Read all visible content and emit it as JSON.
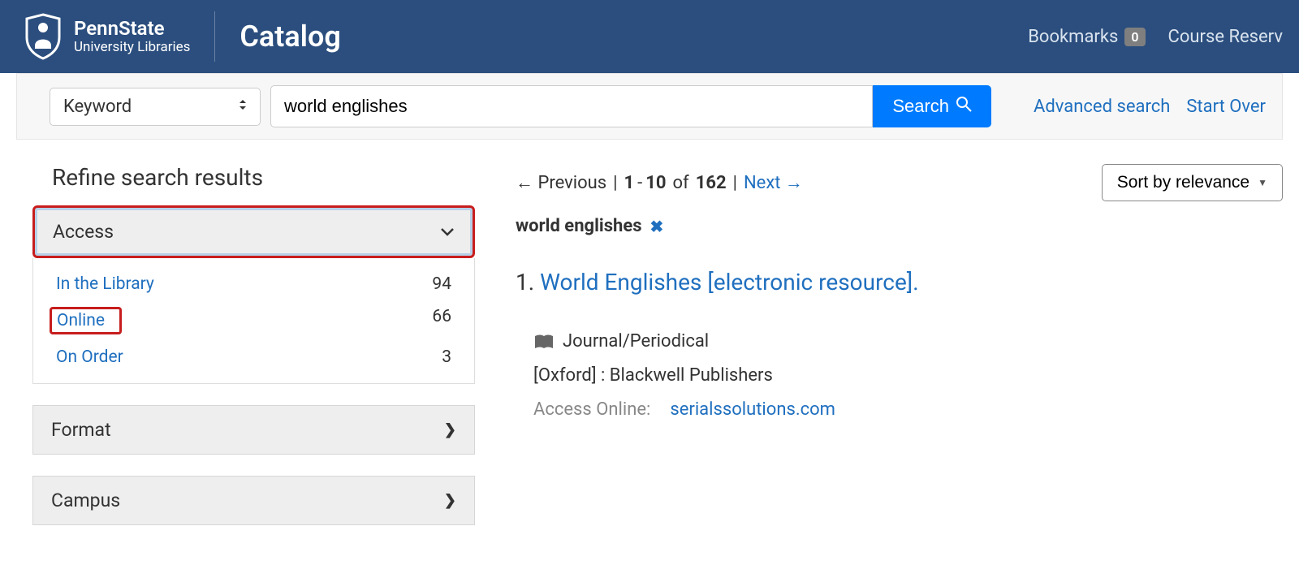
{
  "header": {
    "logo_title": "PennState",
    "logo_sub": "University Libraries",
    "app_title": "Catalog",
    "bookmarks_label": "Bookmarks",
    "bookmarks_count": "0",
    "reserves_label": "Course Reserv"
  },
  "search": {
    "type_label": "Keyword",
    "query": "world englishes",
    "button_label": "Search",
    "advanced_label": "Advanced search",
    "start_over_label": "Start Over"
  },
  "sidebar": {
    "heading": "Refine search results",
    "facets": [
      {
        "name": "Access",
        "open": true,
        "items": [
          {
            "label": "In the Library",
            "count": "94"
          },
          {
            "label": "Online",
            "count": "66",
            "highlight": true
          },
          {
            "label": "On Order",
            "count": "3"
          }
        ]
      },
      {
        "name": "Format",
        "open": false
      },
      {
        "name": "Campus",
        "open": false
      }
    ]
  },
  "results": {
    "pager_prev": "← Previous",
    "pager_sep1": "|",
    "pager_start": "1",
    "pager_dash": " - ",
    "pager_end": "10",
    "pager_of": " of ",
    "pager_total": "162",
    "pager_sep2": "|",
    "pager_next": "Next →",
    "sort_label": "Sort by relevance",
    "active_filter": "world englishes",
    "item": {
      "num": "1.",
      "title": "World Englishes [electronic resource].",
      "type": "Journal/Periodical",
      "publisher": "[Oxford] : Blackwell Publishers",
      "access_label": "Access Online:",
      "access_link": "serialssolutions.com"
    }
  }
}
